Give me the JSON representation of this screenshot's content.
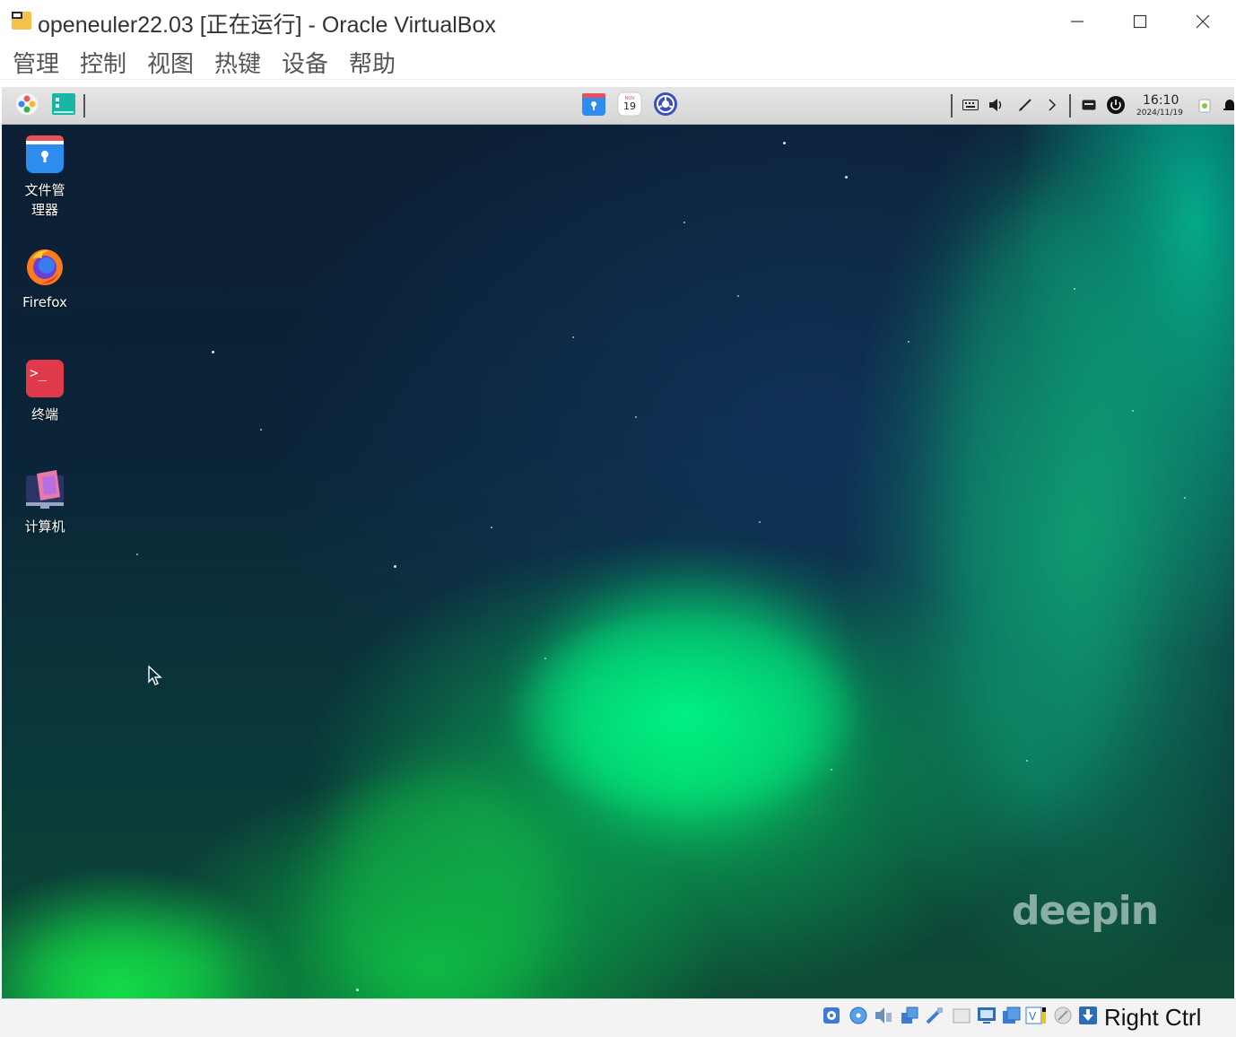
{
  "window": {
    "title": "openeuler22.03 [正在运行] - Oracle VirtualBox",
    "minimize_icon": "minimize-icon",
    "maximize_icon": "maximize-icon",
    "close_icon": "close-icon"
  },
  "menubar": {
    "items": [
      "管理",
      "控制",
      "视图",
      "热键",
      "设备",
      "帮助"
    ]
  },
  "vm": {
    "topbar": {
      "launcher_icon": "launcher-icon",
      "multitask_icon": "multitask-view-icon",
      "dock_apps": [
        "file-manager-icon",
        "calendar-icon",
        "settings-icon"
      ],
      "calendar_month": "NOV",
      "calendar_day": "19",
      "tray_icons": [
        "keyboard-icon",
        "volume-icon",
        "pen-icon",
        "chevron-right-icon",
        "keyboard-layout-icon",
        "power-icon",
        "trash-icon",
        "notification-icon"
      ],
      "clock_time": "16:10",
      "clock_date": "2024/11/19"
    },
    "desktop_icons": [
      {
        "label_line1": "文件管",
        "label_line2": "理器",
        "icon": "file-manager-icon"
      },
      {
        "label_line1": "Firefox",
        "label_line2": "",
        "icon": "firefox-icon"
      },
      {
        "label_line1": "终端",
        "label_line2": "",
        "icon": "terminal-icon"
      },
      {
        "label_line1": "计算机",
        "label_line2": "",
        "icon": "computer-icon"
      }
    ],
    "terminal_glyph": ">_",
    "watermark": "deepin"
  },
  "statusbar": {
    "icons": [
      "hard-disk-icon",
      "optical-drive-icon",
      "audio-icon",
      "network-icon",
      "usb-icon",
      "shared-folder-icon",
      "display-icon",
      "recording-icon",
      "cpu-icon",
      "mouse-integration-icon",
      "keyboard-capture-icon"
    ],
    "host_key": "Right Ctrl"
  },
  "colors": {
    "dock_bg": "#dcdcdc",
    "terminal_red": "#e0394a",
    "file_manager_blue": "#2d8cf0",
    "aurora_green": "#14d860"
  }
}
